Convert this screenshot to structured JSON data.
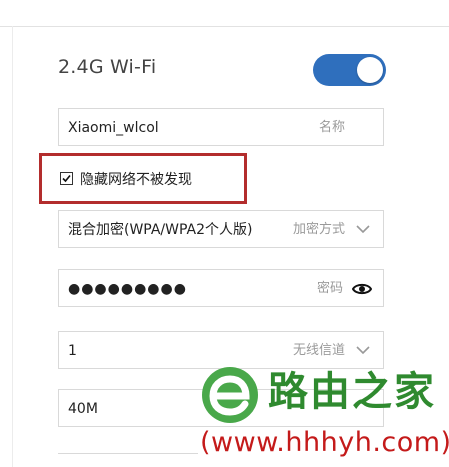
{
  "wifi": {
    "title": "2.4G Wi-Fi",
    "enabled": true,
    "name": {
      "value": "Xiaomi_wlcol",
      "label": "名称"
    },
    "hide_network": {
      "checked": true,
      "label": "隐藏网络不被发现"
    },
    "encryption": {
      "value": "混合加密(WPA/WPA2个人版)",
      "label": "加密方式",
      "icon": "chevron-down-icon"
    },
    "password": {
      "value": "●●●●●●●●●",
      "label": "密码",
      "icon": "eye-icon"
    },
    "channel": {
      "value": "1",
      "label": "无线信道",
      "icon": "chevron-down-icon"
    },
    "bandwidth": {
      "value": "40M"
    }
  },
  "watermark": {
    "site_name": "路由之家",
    "url": "(www.hhhyh.com)",
    "logo_icon": "e-logo-icon"
  },
  "colors": {
    "toggle_on": "#2f6fbd",
    "highlight_border": "#b32d2d",
    "watermark_green": "#2f8a2f",
    "watermark_red": "#c41a1a"
  }
}
